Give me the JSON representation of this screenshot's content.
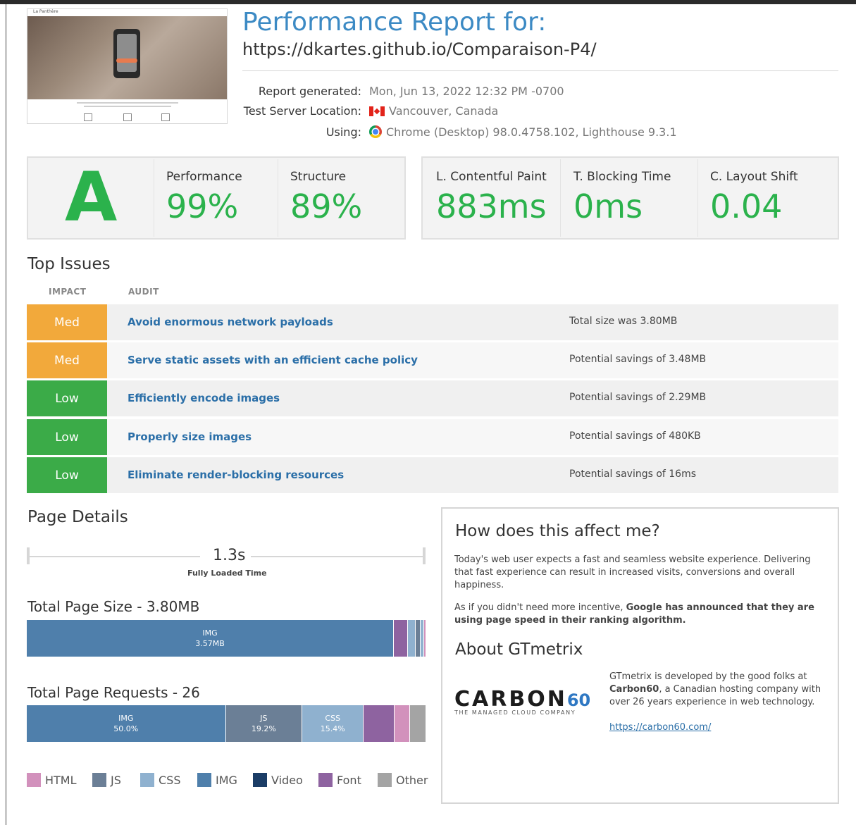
{
  "header": {
    "title": "Performance Report for:",
    "url": "https://dkartes.github.io/Comparaison-P4/",
    "thumbnail_alt": "La Panthère",
    "meta": [
      {
        "label": "Report generated:",
        "value": "Mon, Jun 13, 2022 12:32 PM -0700"
      },
      {
        "label": "Test Server Location:",
        "value": "Vancouver, Canada"
      },
      {
        "label": "Using:",
        "value": "Chrome (Desktop) 98.0.4758.102, Lighthouse 9.3.1"
      }
    ]
  },
  "scores": {
    "grade": "A",
    "performance": {
      "label": "Performance",
      "value": "99%"
    },
    "structure": {
      "label": "Structure",
      "value": "89%"
    },
    "lcp": {
      "label": "L. Contentful Paint",
      "value": "883ms"
    },
    "tbt": {
      "label": "T. Blocking Time",
      "value": "0ms"
    },
    "cls": {
      "label": "C. Layout Shift",
      "value": "0.04"
    },
    "good_color": "#2bb24c"
  },
  "top_issues": {
    "title": "Top Issues",
    "col_impact": "IMPACT",
    "col_audit": "AUDIT",
    "rows": [
      {
        "impact": "Med",
        "audit": "Avoid enormous network payloads",
        "detail": "Total size was 3.80MB"
      },
      {
        "impact": "Med",
        "audit": "Serve static assets with an efficient cache policy",
        "detail": "Potential savings of 3.48MB"
      },
      {
        "impact": "Low",
        "audit": "Efficiently encode images",
        "detail": "Potential savings of 2.29MB"
      },
      {
        "impact": "Low",
        "audit": "Properly size images",
        "detail": "Potential savings of 480KB"
      },
      {
        "impact": "Low",
        "audit": "Eliminate render-blocking resources",
        "detail": "Potential savings of 16ms"
      }
    ],
    "colors": {
      "med": "#f2a93b",
      "low": "#3bab48"
    }
  },
  "page_details": {
    "title": "Page Details",
    "fully_loaded_value": "1.3s",
    "fully_loaded_label": "Fully Loaded Time",
    "size_title": "Total Page Size - 3.80MB",
    "size_segments": [
      {
        "type": "IMG",
        "label": "IMG",
        "value": "3.57MB",
        "fraction": 0.92
      },
      {
        "type": "Font",
        "label": "",
        "value": "",
        "fraction": 0.036
      },
      {
        "type": "CSS",
        "label": "",
        "value": "",
        "fraction": 0.02
      },
      {
        "type": "JS",
        "label": "",
        "value": "",
        "fraction": 0.012
      },
      {
        "type": "CSS",
        "label": "",
        "value": "",
        "fraction": 0.008
      },
      {
        "type": "HTML",
        "label": "",
        "value": "",
        "fraction": 0.004
      }
    ],
    "requests_title": "Total Page Requests - 26",
    "request_segments": [
      {
        "type": "IMG",
        "label": "IMG",
        "value": "50.0%",
        "fraction": 0.5
      },
      {
        "type": "JS",
        "label": "JS",
        "value": "19.2%",
        "fraction": 0.192
      },
      {
        "type": "CSS",
        "label": "CSS",
        "value": "15.4%",
        "fraction": 0.154
      },
      {
        "type": "Font",
        "label": "",
        "value": "",
        "fraction": 0.077
      },
      {
        "type": "HTML",
        "label": "",
        "value": "",
        "fraction": 0.038
      },
      {
        "type": "Other",
        "label": "",
        "value": "",
        "fraction": 0.039
      }
    ],
    "legend": [
      {
        "label": "HTML",
        "color": "#d291bc"
      },
      {
        "label": "JS",
        "color": "#6b7f96"
      },
      {
        "label": "CSS",
        "color": "#8fb1cf"
      },
      {
        "label": "IMG",
        "color": "#4f7fab"
      },
      {
        "label": "Video",
        "color": "#1b3d66"
      },
      {
        "label": "Font",
        "color": "#8e63a0"
      },
      {
        "label": "Other",
        "color": "#a4a4a4"
      }
    ]
  },
  "info": {
    "affect_title": "How does this affect me?",
    "affect_p1": "Today's web user expects a fast and seamless website experience. Delivering that fast experience can result in increased visits, conversions and overall happiness.",
    "affect_p2_lead": "As if you didn't need more incentive, ",
    "affect_p2_bold": "Google has announced that they are using page speed in their ranking algorithm.",
    "about_title": "About GTmetrix",
    "carbon_word": "CARBON",
    "carbon_num": "60",
    "carbon_tagline": "THE MANAGED CLOUD COMPANY",
    "gt_p_lead": "GTmetrix is developed by the good folks at ",
    "gt_p_bold": "Carbon60",
    "gt_p_rest": ", a Canadian hosting company with over 26 years experience in web technology.",
    "link": "https://carbon60.com/"
  }
}
